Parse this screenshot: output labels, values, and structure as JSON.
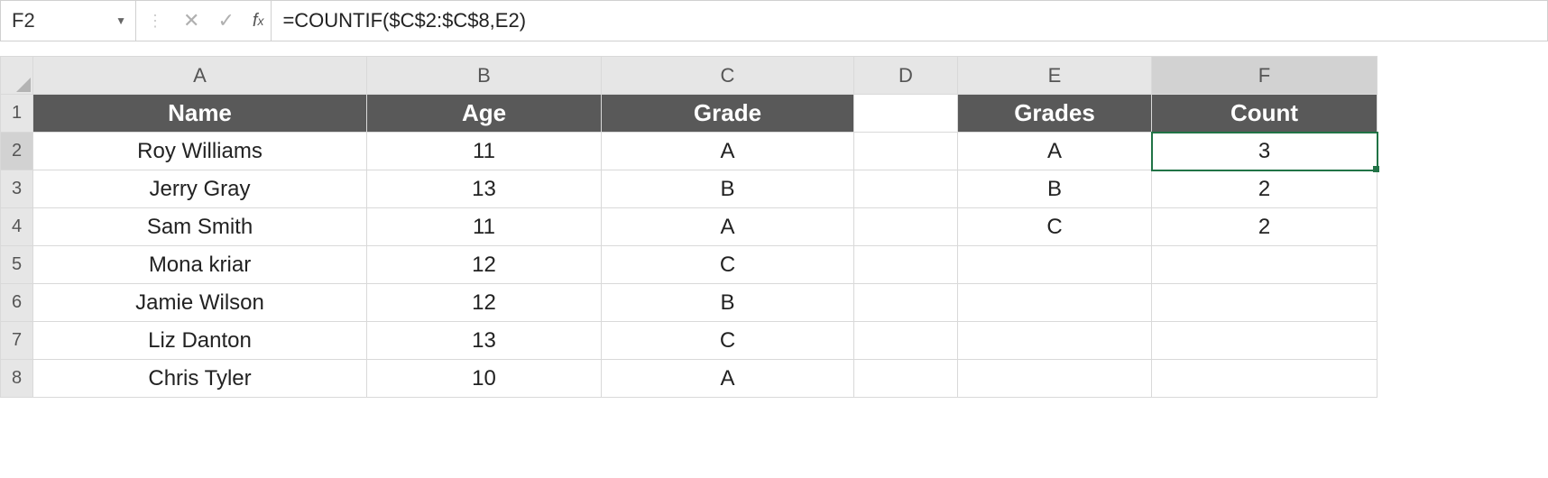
{
  "formulaBar": {
    "nameBox": "F2",
    "formula": "=COUNTIF($C$2:$C$8,E2)"
  },
  "columns": [
    "A",
    "B",
    "C",
    "D",
    "E",
    "F"
  ],
  "rowNumbers": [
    "1",
    "2",
    "3",
    "4",
    "5",
    "6",
    "7",
    "8"
  ],
  "headers": {
    "A": "Name",
    "B": "Age",
    "C": "Grade",
    "E": "Grades",
    "F": "Count"
  },
  "rows": [
    {
      "A": "Roy Williams",
      "B": "11",
      "C": "A",
      "E": "A",
      "F": "3"
    },
    {
      "A": "Jerry Gray",
      "B": "13",
      "C": "B",
      "E": "B",
      "F": "2"
    },
    {
      "A": "Sam Smith",
      "B": "11",
      "C": "A",
      "E": "C",
      "F": "2"
    },
    {
      "A": "Mona kriar",
      "B": "12",
      "C": "C"
    },
    {
      "A": "Jamie Wilson",
      "B": "12",
      "C": "B"
    },
    {
      "A": "Liz Danton",
      "B": "13",
      "C": "C"
    },
    {
      "A": "Chris Tyler",
      "B": "10",
      "C": "A"
    }
  ],
  "selectedCell": "F2"
}
